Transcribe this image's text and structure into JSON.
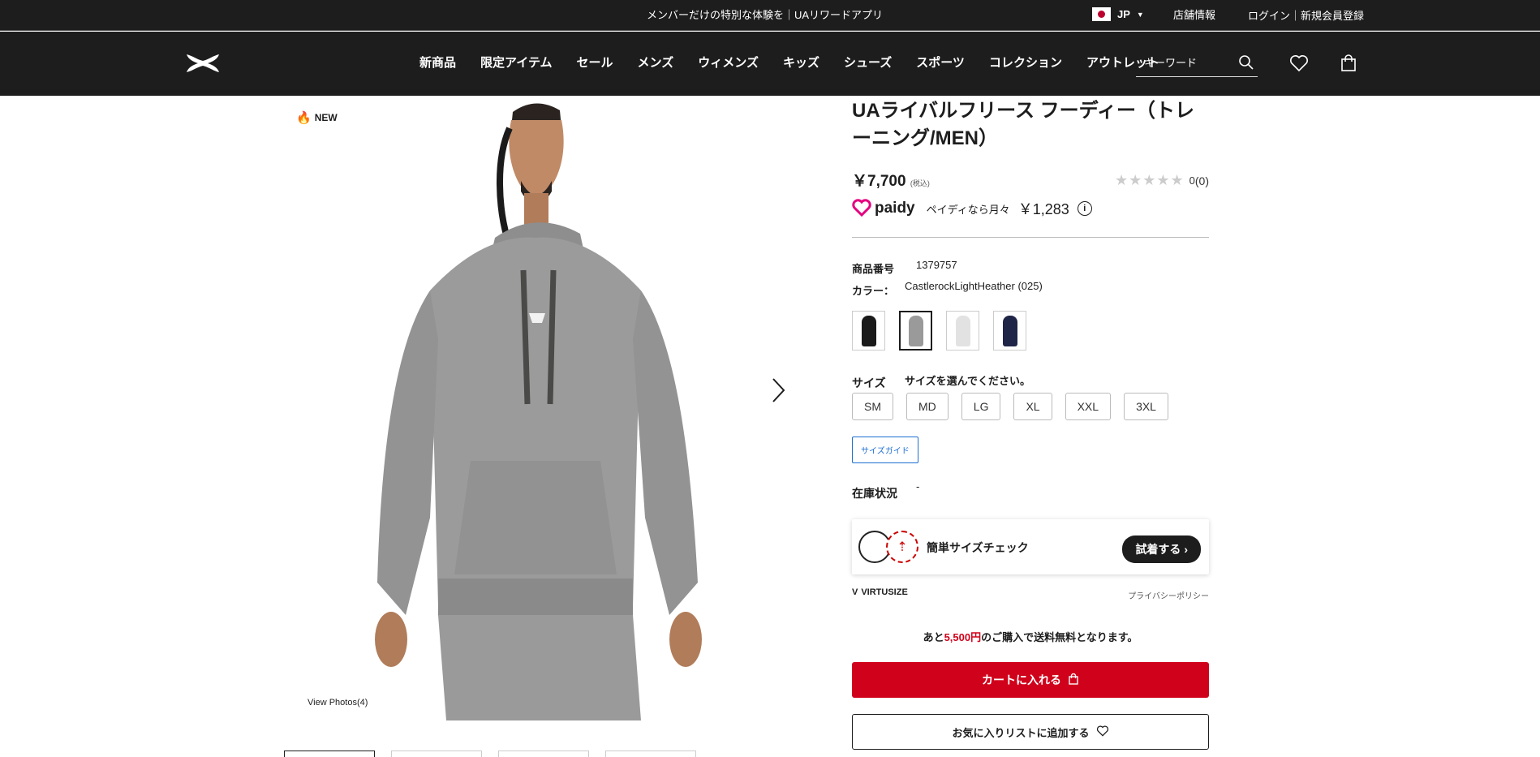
{
  "topbar": {
    "promo": "メンバーだけの特別な体験を｜UAリワードアプリ",
    "locale": "JP",
    "stores": "店舗情報",
    "login": "ログイン｜新規会員登録"
  },
  "nav": {
    "items": [
      "新商品",
      "限定アイテム",
      "セール",
      "メンズ",
      "ウィメンズ",
      "キッズ",
      "シューズ",
      "スポーツ",
      "コレクション",
      "アウトレット"
    ],
    "search_placeholder": "キーワード"
  },
  "gallery": {
    "badge": "NEW",
    "view_photos": "View Photos(4)",
    "thumb_count": 4
  },
  "product": {
    "title": "UAライバルフリース フーディー（トレーニング/MEN）",
    "price": "￥7,700",
    "tax_note": "(税込)",
    "rating_text": "0",
    "review_count": "(0)",
    "rating_value": 0,
    "paidy_logo": "paidy",
    "paidy_text": "ペイディなら月々",
    "paidy_amount": "￥1,283",
    "sku_label": "商品番号",
    "sku": "1379757",
    "color_label": "カラー：",
    "color_value": "CastlerockLightHeather (025)",
    "swatch_colors": [
      "#1a1a1a",
      "#9a9a9a",
      "#e2e2e2",
      "#1f2547"
    ],
    "size_label": "サイズ",
    "size_prompt": "サイズを選んでください。",
    "sizes": [
      "SM",
      "MD",
      "LG",
      "XL",
      "XXL",
      "3XL"
    ],
    "size_guide": "サイズガイド",
    "stock_label": "在庫状況",
    "stock_value": "-",
    "virtusize_text": "簡単サイズチェック",
    "virtusize_button": "試着する",
    "virtusize_brand": "VIRTUSIZE",
    "privacy": "プライバシーポリシー",
    "ship_prefix": "あと",
    "ship_amount": "5,500円",
    "ship_suffix": "のご購入で送料無料となります。",
    "cart_button": "カートに入れる",
    "wishlist_button": "お気に入りリストに追加する"
  },
  "colors": {
    "dark": "#1d1d1d",
    "accent_red": "#d0021b",
    "link_blue": "#1c6fd1"
  }
}
